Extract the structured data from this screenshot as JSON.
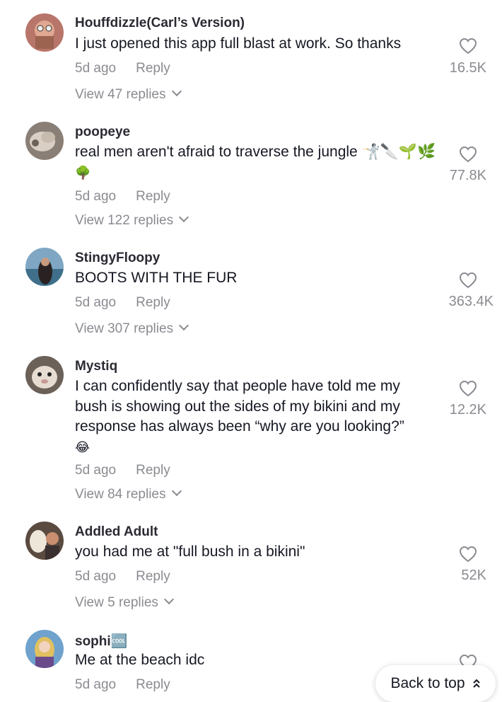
{
  "comments": [
    {
      "username": "Houffdizzle(Carl’s Version)",
      "text_lines": [
        "I just opened this app full blast at work. So thanks"
      ],
      "time": "5d ago",
      "reply_label": "Reply",
      "likes": "16.5K",
      "view_replies": "View 47 replies"
    },
    {
      "username": "poopeye",
      "text_lines": [
        "real men aren't afraid to traverse the jungle 🤺🔪🌱🌿",
        "🌳"
      ],
      "time": "5d ago",
      "reply_label": "Reply",
      "likes": "77.8K",
      "view_replies": "View 122 replies"
    },
    {
      "username": "StingyFloopy",
      "text_lines": [
        "BOOTS WITH THE FUR"
      ],
      "time": "5d ago",
      "reply_label": "Reply",
      "likes": "363.4K",
      "view_replies": "View 307 replies"
    },
    {
      "username": "Mystiq",
      "text_lines": [
        "I can confidently say that people have told me my",
        "bush is showing out the sides of my bikini and my",
        "response has always been “why are you looking?”",
        "😂"
      ],
      "time": "5d ago",
      "reply_label": "Reply",
      "likes": "12.2K",
      "view_replies": "View 84 replies"
    },
    {
      "username": "Addled Adult",
      "text_lines": [
        "you had me at \"full bush in a bikini\""
      ],
      "time": "5d ago",
      "reply_label": "Reply",
      "likes": "52K",
      "view_replies": "View 5 replies"
    },
    {
      "username": "sophi🆒",
      "text_lines": [
        "Me at the beach idc"
      ],
      "time": "5d ago",
      "reply_label": "Reply",
      "likes": "",
      "view_replies": ""
    }
  ],
  "back_to_top": {
    "label": "Back to top",
    "icon": "double-chevron-up-icon"
  },
  "icons": {
    "like": "heart-outline-icon",
    "expand": "chevron-down-icon"
  },
  "colors": {
    "text": "#161823",
    "muted": "#8a8b91",
    "background": "#ffffff"
  }
}
